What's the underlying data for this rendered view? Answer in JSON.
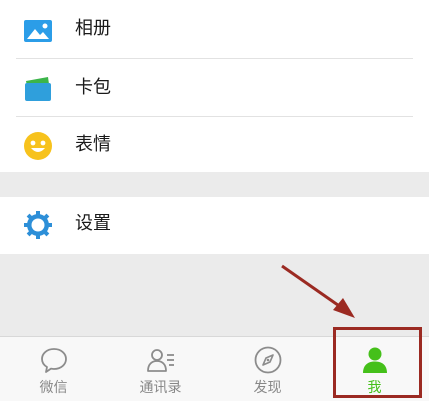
{
  "menu": {
    "album_label": "相册",
    "cards_label": "卡包",
    "stickers_label": "表情",
    "settings_label": "设置"
  },
  "tabbar": {
    "tabs": [
      {
        "label": "微信",
        "icon": "chat-bubble-icon"
      },
      {
        "label": "通讯录",
        "icon": "contacts-icon"
      },
      {
        "label": "发现",
        "icon": "compass-icon"
      },
      {
        "label": "我",
        "icon": "person-icon"
      }
    ],
    "active_index": 3
  },
  "colors": {
    "accent_green": "#45c01a",
    "album_blue": "#2b9de8",
    "cards_blue": "#2f9fdc",
    "cards_green": "#3cb54a",
    "sticker_yellow": "#f7c21c",
    "settings_blue": "#2d8fd8",
    "annotation_red": "#9b2a22"
  }
}
